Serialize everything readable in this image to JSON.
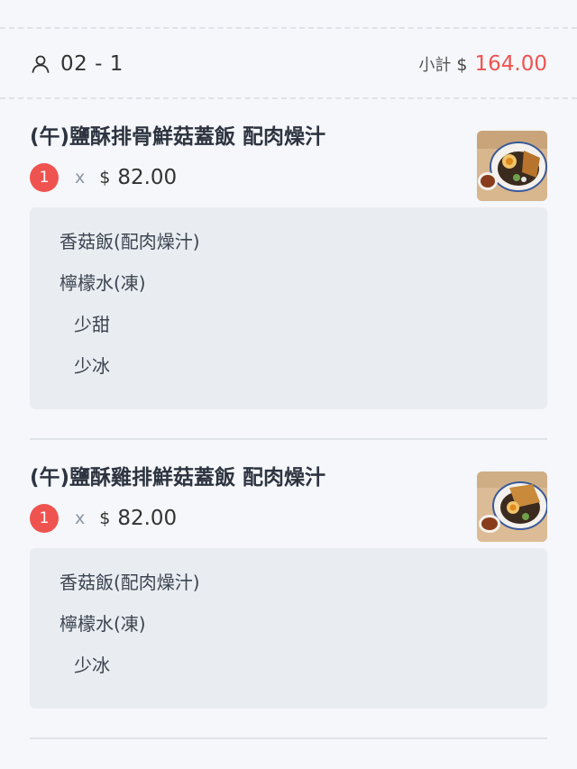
{
  "header": {
    "table_label": "02 - 1",
    "subtotal_label": "小計",
    "currency": "$",
    "subtotal_amount": "164.00"
  },
  "items": [
    {
      "title": "(午)鹽酥排骨鮮菇蓋飯 配肉燥汁",
      "qty": "1",
      "times": "x",
      "currency": "$",
      "price": "82.00",
      "options": [
        "香菇飯(配肉燥汁)",
        "檸檬水(凍)",
        "少甜",
        "少冰"
      ]
    },
    {
      "title": "(午)鹽酥雞排鮮菇蓋飯 配肉燥汁",
      "qty": "1",
      "times": "x",
      "currency": "$",
      "price": "82.00",
      "options": [
        "香菇飯(配肉燥汁)",
        "檸檬水(凍)",
        "少冰"
      ]
    }
  ],
  "colors": {
    "accent": "#ef5350",
    "background": "#f5f7fa",
    "option_box": "#e9edf2"
  },
  "icons": {
    "person": "user-icon"
  }
}
